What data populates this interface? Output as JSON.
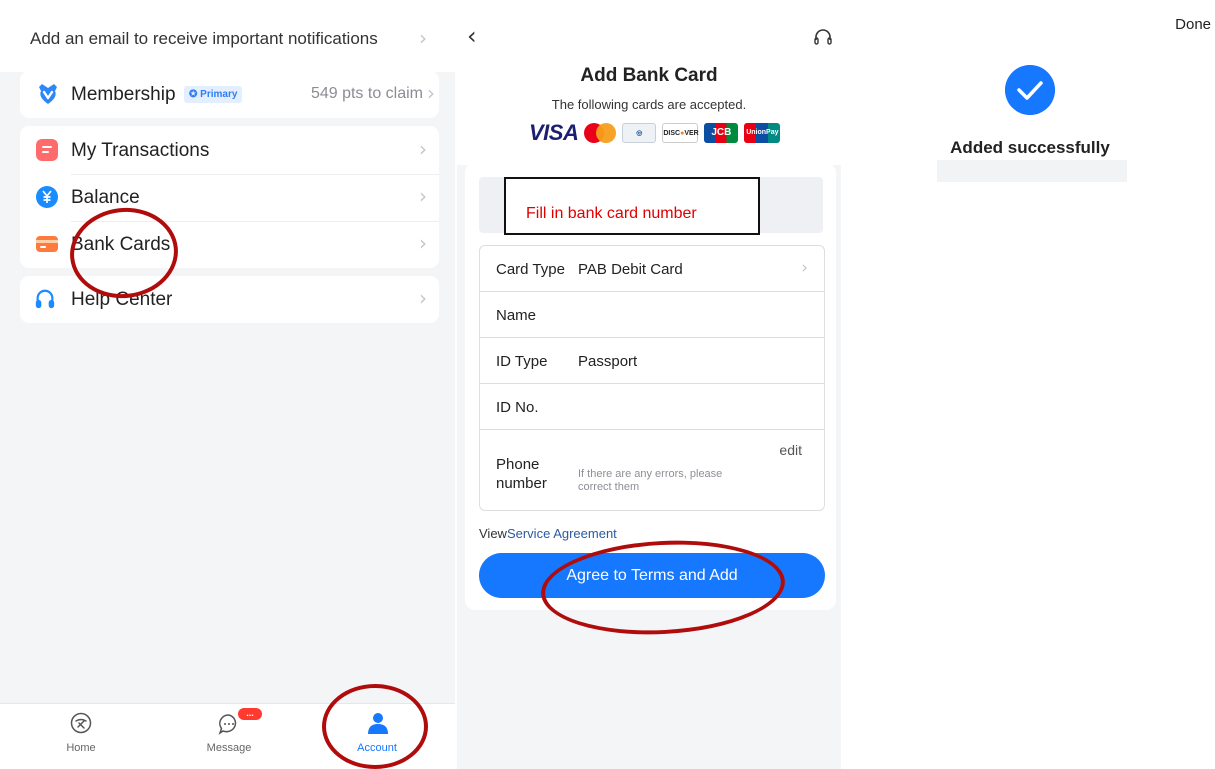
{
  "account_screen": {
    "email_prompt": "Add an email to receive important notifications",
    "membership": {
      "label": "Membership",
      "badge": "Primary",
      "points": "549 pts to claim"
    },
    "menu": [
      {
        "label": "My Transactions",
        "icon": "transactions-icon",
        "color": "#ff6b6b"
      },
      {
        "label": "Balance",
        "icon": "yuan-coin-icon",
        "color": "#1a8cff"
      },
      {
        "label": "Bank Cards",
        "icon": "bank-card-icon",
        "color": "#ff7a3d"
      }
    ],
    "help": {
      "label": "Help Center",
      "icon": "headset-icon",
      "color": "#1a8cff"
    },
    "tabs": [
      {
        "label": "Home",
        "icon": "home-icon"
      },
      {
        "label": "Message",
        "icon": "chat-bubble-icon",
        "badge": "..."
      },
      {
        "label": "Account",
        "icon": "person-icon",
        "active": true
      }
    ]
  },
  "add_card_screen": {
    "title": "Add Bank Card",
    "subtitle": "The following cards are accepted.",
    "logos": [
      "VISA",
      "Mastercard",
      "Diners Club",
      "DISCOVER",
      "JCB",
      "UnionPay"
    ],
    "card_number_annotation": "Fill in bank card number",
    "fields": {
      "card_type_label": "Card Type",
      "card_type_value": "PAB  Debit Card",
      "name_label": "Name",
      "id_type_label": "ID Type",
      "id_type_value": "Passport",
      "id_no_label": "ID No.",
      "phone_label": "Phone number",
      "phone_hint": "If there are any errors, please correct them",
      "edit_label": "edit"
    },
    "agreement_view": "View",
    "agreement_link": "Service Agreement",
    "submit_label": "Agree to Terms and Add"
  },
  "success_screen": {
    "done_label": "Done",
    "message": "Added successfully"
  },
  "colors": {
    "primary": "#1677ff",
    "annotation_red": "#b10c0c"
  }
}
